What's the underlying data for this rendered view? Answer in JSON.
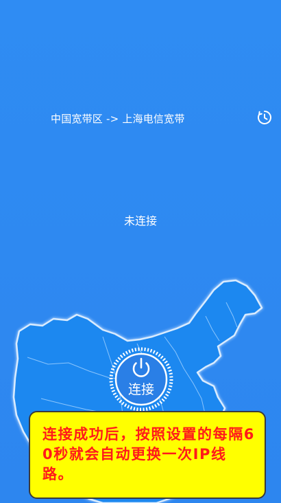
{
  "route": {
    "text": "中国宽带区 -> 上海电信宽带",
    "icon": "timer-icon"
  },
  "status": {
    "text": "未连接"
  },
  "connect": {
    "label": "连接",
    "icon": "power-icon"
  },
  "tip": {
    "text": "连接成功后，按照设置的每隔60秒就会自动更换一次IP线路。"
  },
  "colors": {
    "background": "#2f8cf3",
    "map_fill": "#1e88f0",
    "map_border": "#bfe0ff",
    "tip_background": "#ffff00",
    "tip_text": "#ff1a1a"
  }
}
